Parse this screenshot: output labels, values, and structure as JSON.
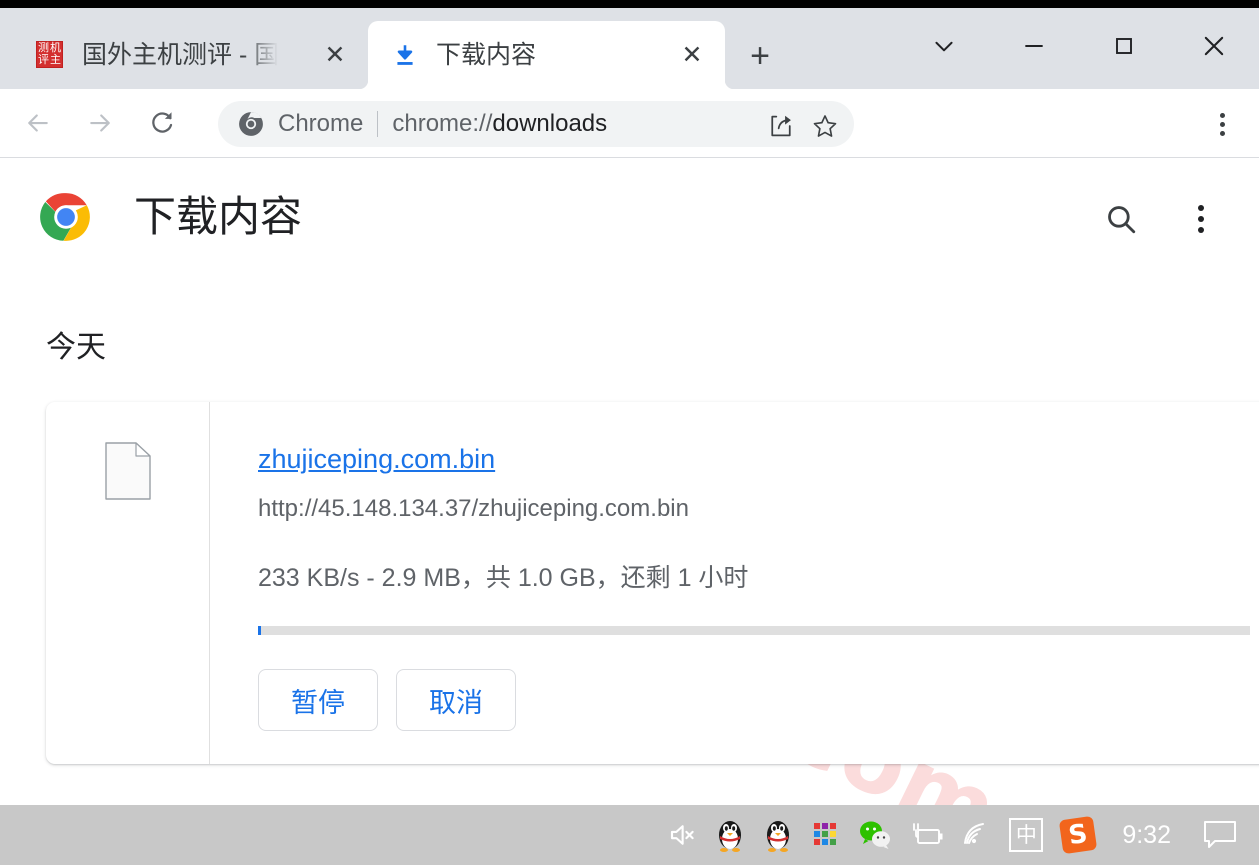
{
  "window": {
    "controls": {
      "tab_search": "chevron-down",
      "minimize": "minimize",
      "maximize": "maximize",
      "close": "close"
    }
  },
  "tabstrip": {
    "tabs": [
      {
        "title": "国外主机测评 - 国外V",
        "active": false,
        "favicon": "site-favicon-red-seal",
        "close_label": "✕"
      },
      {
        "title": "下载内容",
        "active": true,
        "favicon": "download-arrow-icon",
        "close_label": "✕"
      }
    ],
    "new_tab_label": "+"
  },
  "toolbar": {
    "back_label": "←",
    "forward_label": "→",
    "reload_label": "⟳",
    "omnibox": {
      "chip_label": "Chrome",
      "url_scheme": "chrome://",
      "url_path": "downloads",
      "url_full": "chrome://downloads",
      "share_icon": "share-icon",
      "star_icon": "star-icon"
    },
    "menu_icon": "three-dot-menu-icon"
  },
  "page": {
    "watermark": "zhujiceping.com",
    "watermark_color": "#fbdcdc",
    "logo": "chrome-logo",
    "title": "下载内容",
    "search_icon": "search-icon",
    "menu_icon": "three-dot-menu-icon",
    "day_group": "今天",
    "accent_color": "#1a73e8",
    "download": {
      "file_icon": "generic-file-icon",
      "filename": "zhujiceping.com.bin",
      "url": "http://45.148.134.37/zhujiceping.com.bin",
      "status": "233 KB/s - 2.9 MB，共 1.0 GB，还剩 1 小时",
      "speed": "233 KB/s",
      "downloaded": "2.9 MB",
      "total_size": "1.0 GB",
      "time_remaining": "还剩 1 小时",
      "progress_percent": 0.3,
      "pause_label": "暂停",
      "cancel_label": "取消"
    }
  },
  "taskbar": {
    "icons": [
      "speaker-muted-icon",
      "qq-penguin-icon",
      "qq-penguin-icon",
      "color-squares-icon",
      "wechat-icon",
      "battery-charging-icon",
      "wifi-icon",
      "ime-chinese-icon",
      "sogou-icon"
    ],
    "ime_label": "中",
    "sogou_label": "S",
    "clock": "9:32",
    "notification_icon": "notification-icon"
  }
}
